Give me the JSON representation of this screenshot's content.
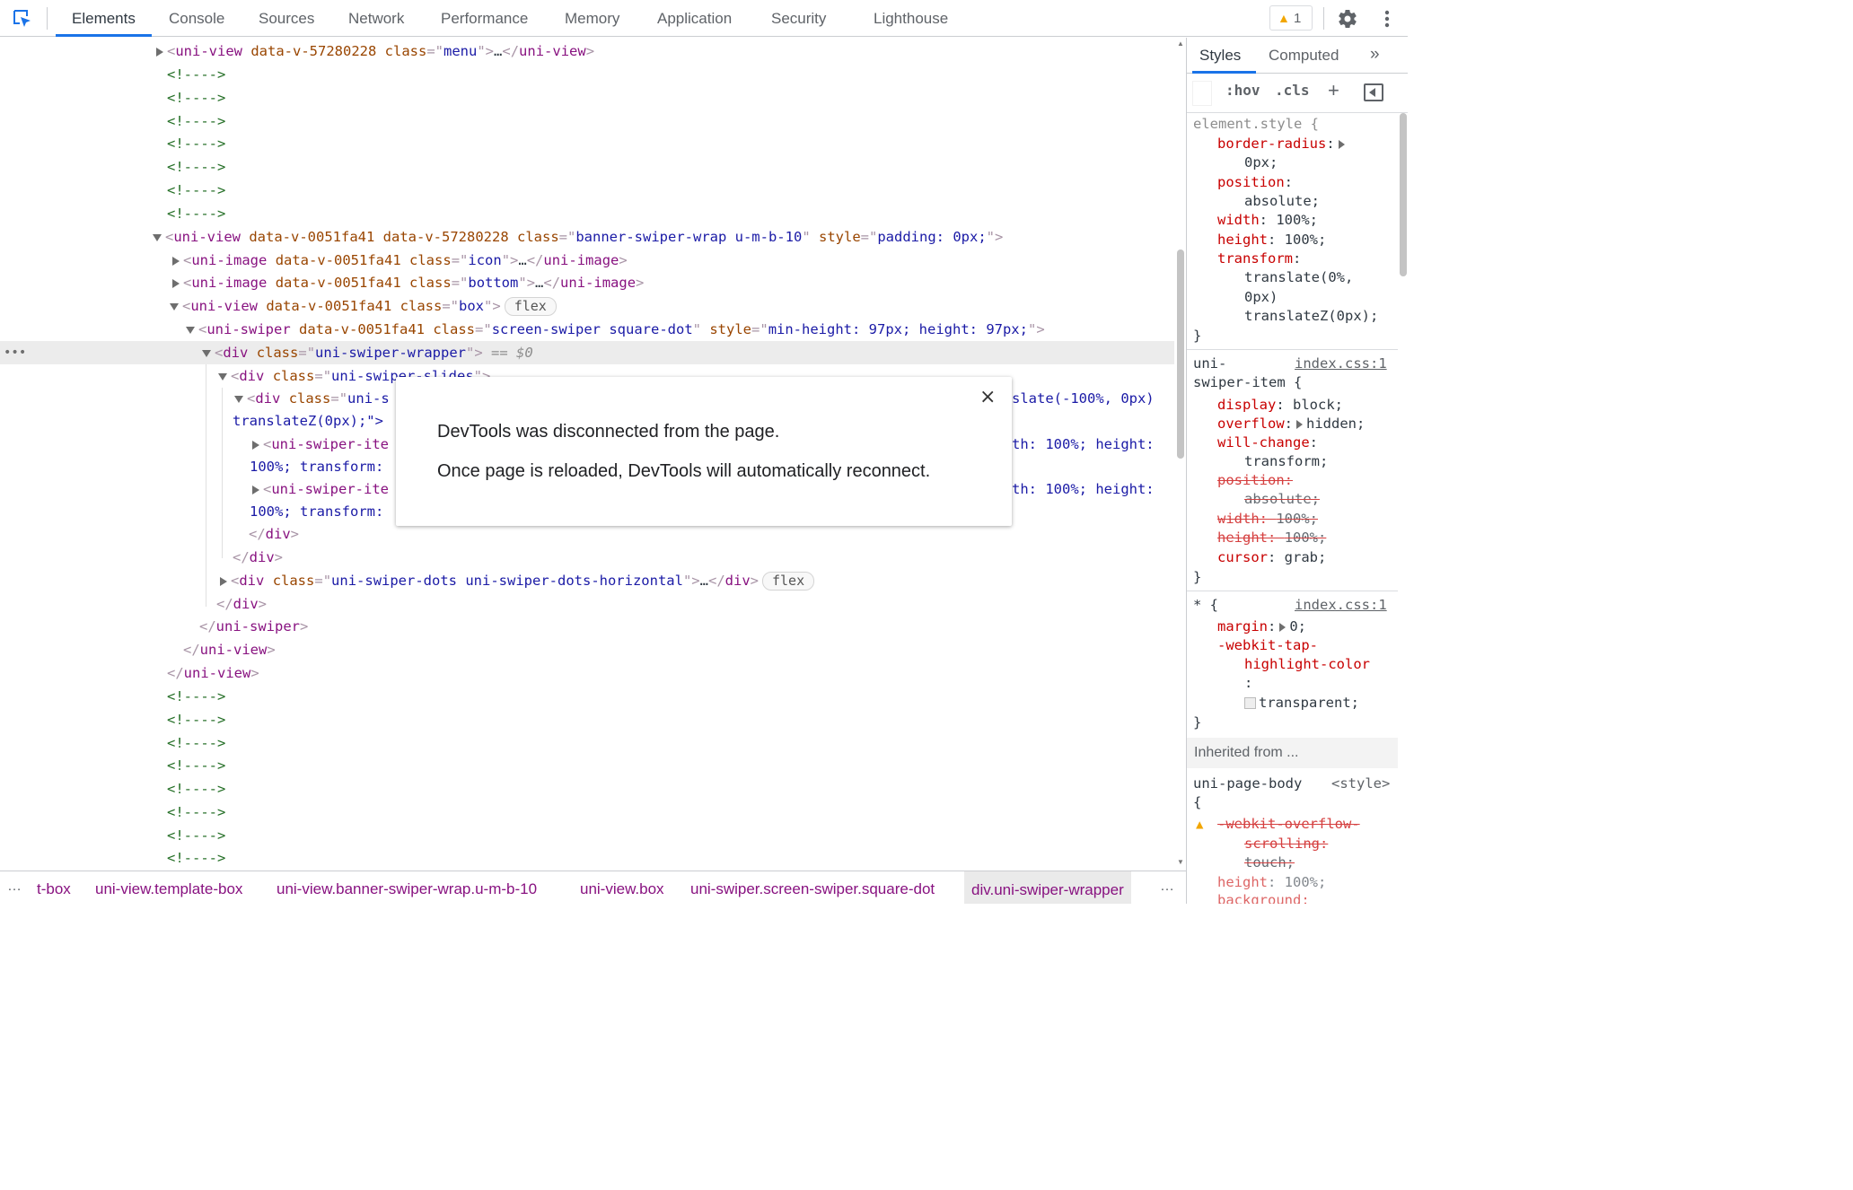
{
  "toolbar": {
    "tabs": [
      "Elements",
      "Console",
      "Sources",
      "Network",
      "Performance",
      "Memory",
      "Application",
      "Security",
      "Lighthouse"
    ],
    "active_tab": "Elements",
    "warnings_count": "1"
  },
  "dom": {
    "lines": [
      {
        "t": "menu_line"
      },
      {
        "t": "comment",
        "text": "<!---->"
      }
    ],
    "menu": {
      "tag": "uni-view",
      "attr1": "data-v-57280228",
      "cls": "class",
      "val": "menu"
    },
    "comment": "<!---->",
    "l_banner": {
      "tag": "uni-view",
      "a1": "data-v-0051fa41",
      "a2": "data-v-57280228",
      "cls": "class",
      "cval": "banner-swiper-wrap u-m-b-10",
      "st": "style",
      "sval": "padding: 0px;"
    },
    "l_icon": {
      "tag": "uni-image",
      "a1": "data-v-0051fa41",
      "cls": "class",
      "cval": "icon"
    },
    "l_bottom": {
      "tag": "uni-image",
      "a1": "data-v-0051fa41",
      "cls": "class",
      "cval": "bottom"
    },
    "l_box": {
      "tag": "uni-view",
      "a1": "data-v-0051fa41",
      "cls": "class",
      "cval": "box",
      "badge": "flex"
    },
    "l_swiper": {
      "tag": "uni-swiper",
      "a1": "data-v-0051fa41",
      "cls": "class",
      "cval": "screen-swiper square-dot",
      "st": "style",
      "sval": "min-height: 97px; height: 97px;"
    },
    "l_wrapper": {
      "tag": "div",
      "cls": "class",
      "cval": "uni-swiper-wrapper",
      "dollar": "== $0"
    },
    "l_slides": {
      "tag": "div",
      "cls": "class",
      "cval": "uni-swiper-slides"
    },
    "l_frame_a": {
      "tag": "div",
      "cls": "class",
      "cval_part": "uni-s",
      "tail": "slate(-100%, 0px)"
    },
    "l_frame_b": "translateZ(0px);\">",
    "l_item1a": {
      "tag": "uni-swiper-ite",
      "tail": "th: 100%; height:"
    },
    "l_item1b": "100%; transform:",
    "l_item2a": {
      "tag": "uni-swiper-ite",
      "tail": "th: 100%; height:"
    },
    "l_item2b": "100%; transform:",
    "l_close_div": "div",
    "l_dots": {
      "tag": "div",
      "cls": "class",
      "cval": "uni-swiper-dots uni-swiper-dots-horizontal",
      "badge": "flex"
    },
    "l_close_swiper": "uni-swiper",
    "l_close_view": "uni-view",
    "ellipsis": "…"
  },
  "styles": {
    "tabs": [
      "Styles",
      "Computed"
    ],
    "hov": ":hov",
    "cls": ".cls",
    "element_style": {
      "selector": "element.style {",
      "props": [
        {
          "n": "border-radius",
          "v": "0px;"
        },
        {
          "n": "position",
          "v": "absolute;"
        },
        {
          "n": "width",
          "v": "100%;"
        },
        {
          "n": "height",
          "v": "100%;"
        },
        {
          "n": "transform",
          "v1": "translate(0%,",
          "v2": "0px)",
          "v3": "translateZ(0px);"
        }
      ],
      "close": "}"
    },
    "rule2": {
      "sel1": "uni-",
      "sel2": "swiper-item {",
      "source": "index.css:1",
      "display": {
        "n": "display",
        "v": "block;"
      },
      "overflow": {
        "n": "overflow",
        "v": "hidden;"
      },
      "will_change": {
        "n": "will-change",
        "v": "transform;"
      },
      "position": {
        "n": "position",
        "v": "absolute;"
      },
      "width": {
        "n": "width",
        "v": "100%;"
      },
      "height": {
        "n": "height",
        "v": "100%;"
      },
      "cursor": {
        "n": "cursor",
        "v": "grab;"
      },
      "close": "}"
    },
    "rule3": {
      "sel": "* {",
      "source": "index.css:1",
      "margin": {
        "n": "margin",
        "v": "0;"
      },
      "tap1": "-webkit-tap-",
      "tap2": "highlight-color",
      "tap3": ":",
      "tap_v": "transparent;",
      "close": "}"
    },
    "inherited": "Inherited from ...",
    "rule4": {
      "sel": "uni-page-body",
      "source": "<style>",
      "brace": "{",
      "ov1": "-webkit-overflow-",
      "ov2": "scrolling:",
      "ov3": "touch;",
      "height": {
        "n": "height",
        "v": "100%;"
      },
      "bg": "background:"
    }
  },
  "breadcrumb": [
    "t-box",
    "uni-view.template-box",
    "uni-view.banner-swiper-wrap.u-m-b-10",
    "uni-view.box",
    "uni-swiper.screen-swiper.square-dot",
    "div.uni-swiper-wrapper"
  ],
  "dialog": {
    "close": "×",
    "line1": "DevTools was disconnected from the page.",
    "line2": "Once page is reloaded, DevTools will automatically reconnect."
  },
  "colors": {
    "accent": "#1a73e8",
    "tag": "#881280",
    "attr_name": "#994500",
    "attr_value": "#1a1aa6",
    "comment": "#236e25",
    "prop_name": "#c80000",
    "warning": "#f2a600"
  },
  "icons": [
    "inspect-element-icon",
    "warning-icon",
    "gear-icon",
    "kebab-menu-icon",
    "chevron-double-right-icon",
    "plus-icon",
    "sidebar-toggle-icon",
    "close-icon"
  ]
}
